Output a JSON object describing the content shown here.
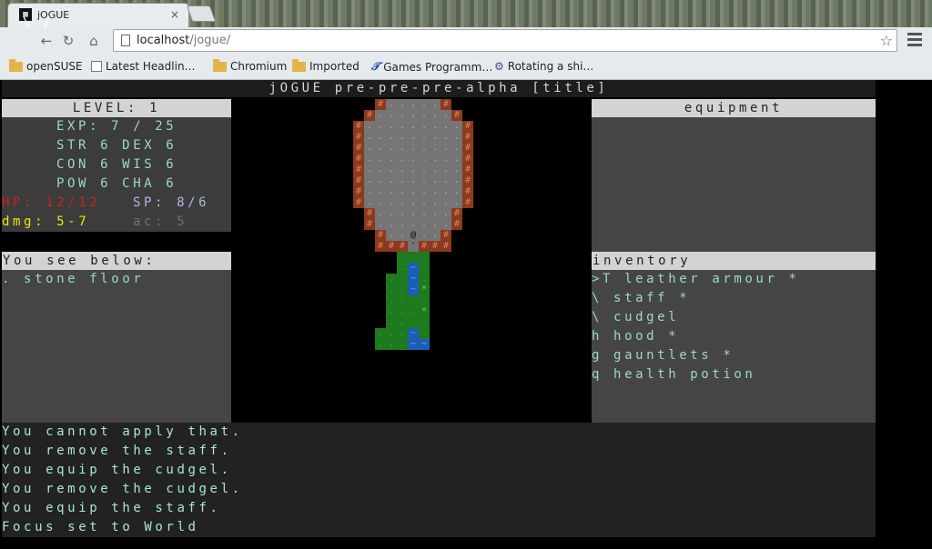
{
  "browser": {
    "tab_title": "jOGUE",
    "tab_close": "×",
    "url_host": "localhost",
    "url_path": "/jogue/",
    "bookmarks": [
      {
        "label": "openSUSE",
        "icon": "folder-icon"
      },
      {
        "label": "Latest Headlin…",
        "icon": "folder-icon"
      },
      {
        "label": "Chromium",
        "icon": "folder-icon"
      },
      {
        "label": "Imported",
        "icon": "folder-icon"
      },
      {
        "label": "Games Programm…",
        "icon": "bookmark-icon"
      },
      {
        "label": "Rotating a shi…",
        "icon": "bookmark-icon"
      }
    ]
  },
  "game": {
    "title": "jOGUE pre-pre-pre-alpha [title]",
    "stats": {
      "level": "LEVEL: 1",
      "exp": "EXP: 7 / 25",
      "str_dex": "STR 6 DEX 6",
      "con_wis": "CON 6 WIS 6",
      "pow_cha": "POW 6 CHA 6",
      "hp": "HP: 12/12",
      "sp": "SP: 8/6",
      "dmg": "dmg: 5-7",
      "ac": "ac: 5"
    },
    "see_below": {
      "header": "You see below:",
      "items": [
        ". stone floor"
      ]
    },
    "equipment": {
      "header": "equipment"
    },
    "inventory": {
      "header": "inventory",
      "items": [
        ">T leather armour *",
        "\\ staff *",
        "\\ cudgel",
        "h hood *",
        "g gauntlets *",
        "q health potion"
      ]
    },
    "messages": [
      "You cannot apply that.",
      "You remove the staff.",
      "You equip the cudgel.",
      "You remove the cudgel.",
      "You equip the staff.",
      "Focus set to World"
    ],
    "colors": {
      "wall": "#8b3a1e",
      "floor": "#757575",
      "grass": "#1e7a1e",
      "water": "#1a5fb4",
      "player": "#000000"
    },
    "glyphs": {
      "wall": "#",
      "floor": ".",
      "water": "~",
      "player": "@",
      "plant": "*"
    }
  }
}
